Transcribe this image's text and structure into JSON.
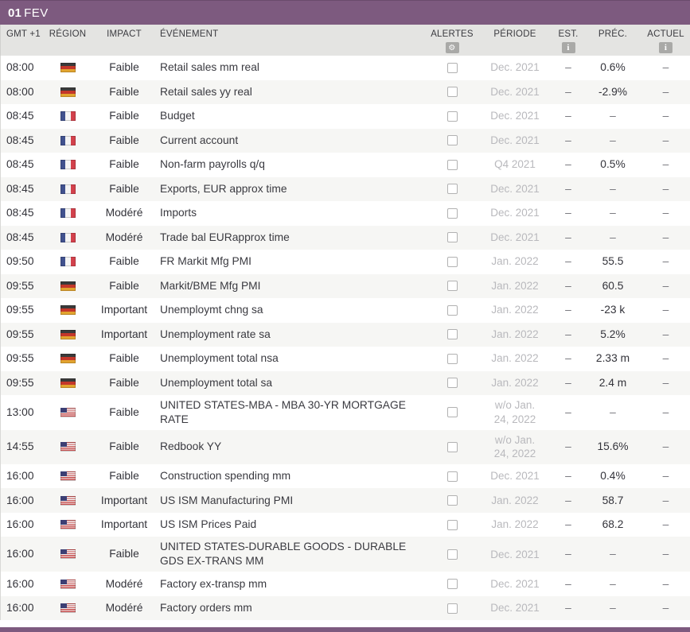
{
  "day_header": {
    "day": "01",
    "month": "FEV"
  },
  "columns": {
    "time": "GMT +1",
    "region": "RÉGION",
    "impact": "IMPACT",
    "event": "ÉVÉNEMENT",
    "alerts": "ALERTES",
    "period": "PÉRIODE",
    "est": "EST.",
    "prev": "PRÉC.",
    "actual": "ACTUEL"
  },
  "icons": {
    "alerts_gear": "⚙",
    "est_info": "i",
    "actual_info": "i"
  },
  "colors": {
    "day_header_bg": "#7d5a7f",
    "column_header_bg": "#e4e4e2",
    "row_alt_bg": "#f6f6f4",
    "text": "#33333a",
    "period_muted": "#b9b9bd",
    "icon_badge_bg": "#a9a9a7"
  },
  "rows": [
    {
      "time": "08:00",
      "region": "germany",
      "impact": "Faible",
      "event": "Retail sales mm real",
      "period": "Dec. 2021",
      "est": "–",
      "prev": "0.6%",
      "actual": "–"
    },
    {
      "time": "08:00",
      "region": "germany",
      "impact": "Faible",
      "event": "Retail sales yy real",
      "period": "Dec. 2021",
      "est": "–",
      "prev": "-2.9%",
      "actual": "–"
    },
    {
      "time": "08:45",
      "region": "france",
      "impact": "Faible",
      "event": "Budget",
      "period": "Dec. 2021",
      "est": "–",
      "prev": "–",
      "actual": "–"
    },
    {
      "time": "08:45",
      "region": "france",
      "impact": "Faible",
      "event": "Current account",
      "period": "Dec. 2021",
      "est": "–",
      "prev": "–",
      "actual": "–"
    },
    {
      "time": "08:45",
      "region": "france",
      "impact": "Faible",
      "event": "Non-farm payrolls q/q",
      "period": "Q4 2021",
      "est": "–",
      "prev": "0.5%",
      "actual": "–"
    },
    {
      "time": "08:45",
      "region": "france",
      "impact": "Faible",
      "event": "Exports, EUR approx time",
      "period": "Dec. 2021",
      "est": "–",
      "prev": "–",
      "actual": "–"
    },
    {
      "time": "08:45",
      "region": "france",
      "impact": "Modéré",
      "event": "Imports",
      "period": "Dec. 2021",
      "est": "–",
      "prev": "–",
      "actual": "–"
    },
    {
      "time": "08:45",
      "region": "france",
      "impact": "Modéré",
      "event": "Trade bal EURapprox time",
      "period": "Dec. 2021",
      "est": "–",
      "prev": "–",
      "actual": "–"
    },
    {
      "time": "09:50",
      "region": "france",
      "impact": "Faible",
      "event": "FR Markit Mfg PMI",
      "period": "Jan. 2022",
      "est": "–",
      "prev": "55.5",
      "actual": "–"
    },
    {
      "time": "09:55",
      "region": "germany",
      "impact": "Faible",
      "event": "Markit/BME Mfg PMI",
      "period": "Jan. 2022",
      "est": "–",
      "prev": "60.5",
      "actual": "–"
    },
    {
      "time": "09:55",
      "region": "germany",
      "impact": "Important",
      "event": "Unemploymt chng sa",
      "period": "Jan. 2022",
      "est": "–",
      "prev": "-23 k",
      "actual": "–"
    },
    {
      "time": "09:55",
      "region": "germany",
      "impact": "Important",
      "event": "Unemployment rate sa",
      "period": "Jan. 2022",
      "est": "–",
      "prev": "5.2%",
      "actual": "–"
    },
    {
      "time": "09:55",
      "region": "germany",
      "impact": "Faible",
      "event": "Unemployment total nsa",
      "period": "Jan. 2022",
      "est": "–",
      "prev": "2.33 m",
      "actual": "–"
    },
    {
      "time": "09:55",
      "region": "germany",
      "impact": "Faible",
      "event": "Unemployment total sa",
      "period": "Jan. 2022",
      "est": "–",
      "prev": "2.4 m",
      "actual": "–"
    },
    {
      "time": "13:00",
      "region": "us",
      "impact": "Faible",
      "event": "UNITED STATES-MBA - MBA 30-YR MORTGAGE RATE",
      "period": "w/o Jan. 24, 2022",
      "est": "–",
      "prev": "–",
      "actual": "–"
    },
    {
      "time": "14:55",
      "region": "us",
      "impact": "Faible",
      "event": "Redbook YY",
      "period": "w/o Jan. 24, 2022",
      "est": "–",
      "prev": "15.6%",
      "actual": "–"
    },
    {
      "time": "16:00",
      "region": "us",
      "impact": "Faible",
      "event": "Construction spending mm",
      "period": "Dec. 2021",
      "est": "–",
      "prev": "0.4%",
      "actual": "–"
    },
    {
      "time": "16:00",
      "region": "us",
      "impact": "Important",
      "event": "US ISM Manufacturing PMI",
      "period": "Jan. 2022",
      "est": "–",
      "prev": "58.7",
      "actual": "–"
    },
    {
      "time": "16:00",
      "region": "us",
      "impact": "Important",
      "event": "US ISM Prices Paid",
      "period": "Jan. 2022",
      "est": "–",
      "prev": "68.2",
      "actual": "–"
    },
    {
      "time": "16:00",
      "region": "us",
      "impact": "Faible",
      "event": "UNITED STATES-DURABLE GOODS - DURABLE GDS EX-TRANS MM",
      "period": "Dec. 2021",
      "est": "–",
      "prev": "–",
      "actual": "–"
    },
    {
      "time": "16:00",
      "region": "us",
      "impact": "Modéré",
      "event": "Factory ex-transp mm",
      "period": "Dec. 2021",
      "est": "–",
      "prev": "–",
      "actual": "–"
    },
    {
      "time": "16:00",
      "region": "us",
      "impact": "Modéré",
      "event": "Factory orders mm",
      "period": "Dec. 2021",
      "est": "–",
      "prev": "–",
      "actual": "–"
    }
  ]
}
